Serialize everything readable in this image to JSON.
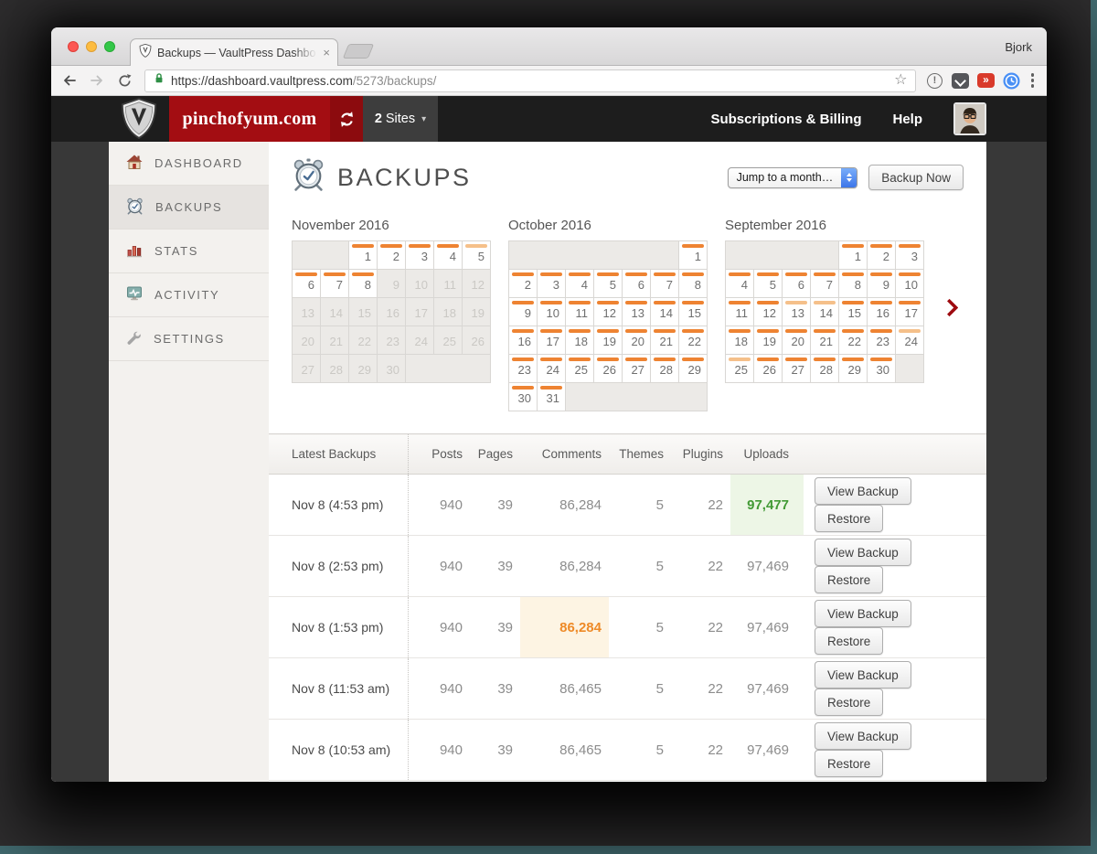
{
  "browser": {
    "profile": "Bjork",
    "tab_title": "Backups — VaultPress Dashbo",
    "tab_close": "×",
    "url_main": "https://dashboard.vaultpress.com",
    "url_path": "/5273/backups/",
    "star": "☆",
    "ext_red_glyph": "»",
    "ext_alert_glyph": "!"
  },
  "nav": {
    "site": "pinchofyum.com",
    "sites_count": "2",
    "sites_label": "Sites",
    "sites_caret": "▾",
    "links": [
      "Subscriptions & Billing",
      "Help"
    ]
  },
  "sidebar": {
    "items": [
      {
        "label": "DASHBOARD",
        "icon": "house-icon",
        "active": false
      },
      {
        "label": "BACKUPS",
        "icon": "alarm-clock-icon",
        "active": true
      },
      {
        "label": "STATS",
        "icon": "bar-chart-icon",
        "active": false
      },
      {
        "label": "ACTIVITY",
        "icon": "activity-monitor-icon",
        "active": false
      },
      {
        "label": "SETTINGS",
        "icon": "wrench-icon",
        "active": false
      }
    ]
  },
  "main": {
    "title": "BACKUPS",
    "month_select_label": "Jump to a month…",
    "backup_now_label": "Backup Now"
  },
  "colors": {
    "bar_solid": "#ee8332",
    "bar_light": "#f5c08a",
    "accent_red": "#a30d12",
    "arrow_red": "#9e0b10",
    "green_text": "#429a35",
    "green_bg": "#edf6e6",
    "orange_text": "#ee8a27",
    "orange_bg": "#fdf4e3"
  },
  "calendars": [
    {
      "title": "November 2016",
      "lead": 2,
      "trail": 3,
      "days": [
        {
          "n": 1,
          "b": "s"
        },
        {
          "n": 2,
          "b": "s"
        },
        {
          "n": 3,
          "b": "s"
        },
        {
          "n": 4,
          "b": "s"
        },
        {
          "n": 5,
          "b": "l"
        },
        {
          "n": 6,
          "b": "s"
        },
        {
          "n": 7,
          "b": "s"
        },
        {
          "n": 8,
          "b": "s"
        },
        {
          "n": 9,
          "b": ""
        },
        {
          "n": 10,
          "b": ""
        },
        {
          "n": 11,
          "b": ""
        },
        {
          "n": 12,
          "b": ""
        },
        {
          "n": 13,
          "b": ""
        },
        {
          "n": 14,
          "b": ""
        },
        {
          "n": 15,
          "b": ""
        },
        {
          "n": 16,
          "b": ""
        },
        {
          "n": 17,
          "b": ""
        },
        {
          "n": 18,
          "b": ""
        },
        {
          "n": 19,
          "b": ""
        },
        {
          "n": 20,
          "b": ""
        },
        {
          "n": 21,
          "b": ""
        },
        {
          "n": 22,
          "b": ""
        },
        {
          "n": 23,
          "b": ""
        },
        {
          "n": 24,
          "b": ""
        },
        {
          "n": 25,
          "b": ""
        },
        {
          "n": 26,
          "b": ""
        },
        {
          "n": 27,
          "b": ""
        },
        {
          "n": 28,
          "b": ""
        },
        {
          "n": 29,
          "b": ""
        },
        {
          "n": 30,
          "b": ""
        }
      ]
    },
    {
      "title": "October 2016",
      "lead": 6,
      "trail": 5,
      "days": [
        {
          "n": 1,
          "b": "s"
        },
        {
          "n": 2,
          "b": "s"
        },
        {
          "n": 3,
          "b": "s"
        },
        {
          "n": 4,
          "b": "s"
        },
        {
          "n": 5,
          "b": "s"
        },
        {
          "n": 6,
          "b": "s"
        },
        {
          "n": 7,
          "b": "s"
        },
        {
          "n": 8,
          "b": "s"
        },
        {
          "n": 9,
          "b": "s"
        },
        {
          "n": 10,
          "b": "s"
        },
        {
          "n": 11,
          "b": "s"
        },
        {
          "n": 12,
          "b": "s"
        },
        {
          "n": 13,
          "b": "s"
        },
        {
          "n": 14,
          "b": "s"
        },
        {
          "n": 15,
          "b": "s"
        },
        {
          "n": 16,
          "b": "s"
        },
        {
          "n": 17,
          "b": "s"
        },
        {
          "n": 18,
          "b": "s"
        },
        {
          "n": 19,
          "b": "s"
        },
        {
          "n": 20,
          "b": "s"
        },
        {
          "n": 21,
          "b": "s"
        },
        {
          "n": 22,
          "b": "s"
        },
        {
          "n": 23,
          "b": "s"
        },
        {
          "n": 24,
          "b": "s"
        },
        {
          "n": 25,
          "b": "s"
        },
        {
          "n": 26,
          "b": "s"
        },
        {
          "n": 27,
          "b": "s"
        },
        {
          "n": 28,
          "b": "s"
        },
        {
          "n": 29,
          "b": "s"
        },
        {
          "n": 30,
          "b": "s"
        },
        {
          "n": 31,
          "b": "s"
        }
      ]
    },
    {
      "title": "September 2016",
      "lead": 4,
      "trail": 1,
      "days": [
        {
          "n": 1,
          "b": "s"
        },
        {
          "n": 2,
          "b": "s"
        },
        {
          "n": 3,
          "b": "s"
        },
        {
          "n": 4,
          "b": "s"
        },
        {
          "n": 5,
          "b": "s"
        },
        {
          "n": 6,
          "b": "s"
        },
        {
          "n": 7,
          "b": "s"
        },
        {
          "n": 8,
          "b": "s"
        },
        {
          "n": 9,
          "b": "s"
        },
        {
          "n": 10,
          "b": "s"
        },
        {
          "n": 11,
          "b": "s"
        },
        {
          "n": 12,
          "b": "s"
        },
        {
          "n": 13,
          "b": "l"
        },
        {
          "n": 14,
          "b": "l"
        },
        {
          "n": 15,
          "b": "s"
        },
        {
          "n": 16,
          "b": "s"
        },
        {
          "n": 17,
          "b": "s"
        },
        {
          "n": 18,
          "b": "s"
        },
        {
          "n": 19,
          "b": "s"
        },
        {
          "n": 20,
          "b": "s"
        },
        {
          "n": 21,
          "b": "s"
        },
        {
          "n": 22,
          "b": "s"
        },
        {
          "n": 23,
          "b": "s"
        },
        {
          "n": 24,
          "b": "l"
        },
        {
          "n": 25,
          "b": "l"
        },
        {
          "n": 26,
          "b": "s"
        },
        {
          "n": 27,
          "b": "s"
        },
        {
          "n": 28,
          "b": "s"
        },
        {
          "n": 29,
          "b": "s"
        },
        {
          "n": 30,
          "b": "s"
        }
      ]
    }
  ],
  "table": {
    "caption": "Latest Backups",
    "headers": [
      "Posts",
      "Pages",
      "Comments",
      "Themes",
      "Plugins",
      "Uploads"
    ],
    "actions": [
      "View Backup",
      "Restore"
    ],
    "rows": [
      {
        "date": "Nov 8 (4:53 pm)",
        "values": [
          "940",
          "39",
          "86,284",
          "5",
          "22",
          "97,477"
        ],
        "hl": {
          "5": "green"
        }
      },
      {
        "date": "Nov 8 (2:53 pm)",
        "values": [
          "940",
          "39",
          "86,284",
          "5",
          "22",
          "97,469"
        ],
        "hl": {}
      },
      {
        "date": "Nov 8 (1:53 pm)",
        "values": [
          "940",
          "39",
          "86,284",
          "5",
          "22",
          "97,469"
        ],
        "hl": {
          "2": "orange"
        }
      },
      {
        "date": "Nov 8 (11:53 am)",
        "values": [
          "940",
          "39",
          "86,465",
          "5",
          "22",
          "97,469"
        ],
        "hl": {}
      },
      {
        "date": "Nov 8 (10:53 am)",
        "values": [
          "940",
          "39",
          "86,465",
          "5",
          "22",
          "97,469"
        ],
        "hl": {}
      }
    ]
  }
}
